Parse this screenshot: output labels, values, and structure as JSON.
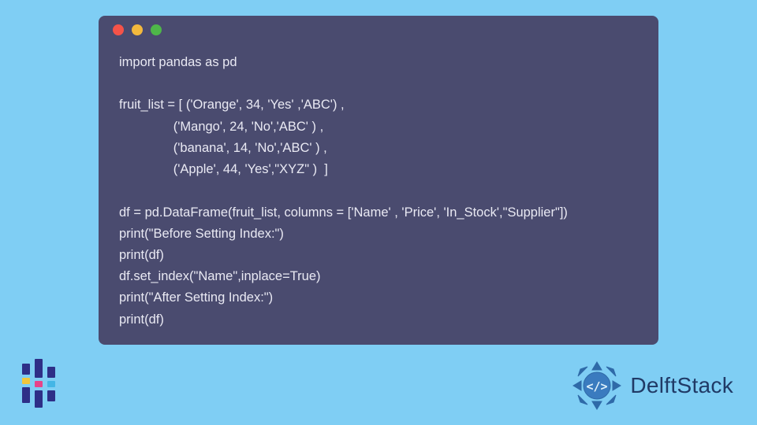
{
  "code": {
    "lines": [
      "import pandas as pd",
      "",
      "fruit_list = [ ('Orange', 34, 'Yes' ,'ABC') ,",
      "               ('Mango', 24, 'No','ABC' ) ,",
      "               ('banana', 14, 'No','ABC' ) ,",
      "               ('Apple', 44, 'Yes',\"XYZ\" )  ]",
      "",
      "df = pd.DataFrame(fruit_list, columns = ['Name' , 'Price', 'In_Stock',\"Supplier\"])",
      "print(\"Before Setting Index:\")",
      "print(df)",
      "df.set_index(\"Name\",inplace=True)",
      "print(\"After Setting Index:\")",
      "print(df)"
    ]
  },
  "window": {
    "dots": [
      "red",
      "yellow",
      "green"
    ]
  },
  "brand": {
    "name": "DelftStack"
  },
  "colors": {
    "page_bg": "#7fcef4",
    "code_bg": "#4a4b6f",
    "code_fg": "#e9e9f3",
    "brand_text": "#203a66",
    "brand_badge": "#2563a8"
  }
}
